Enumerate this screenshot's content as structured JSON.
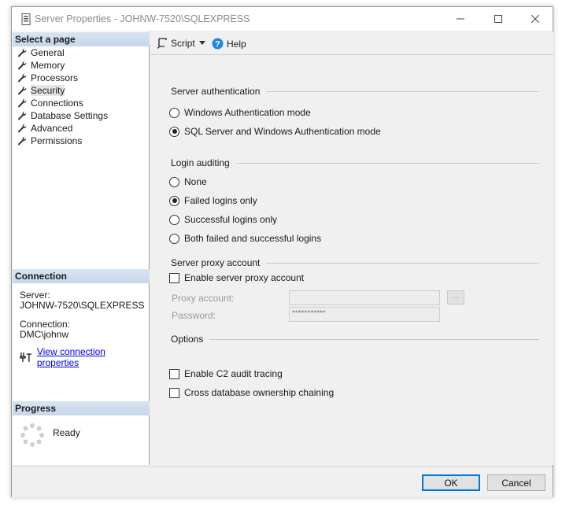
{
  "window": {
    "title": "Server Properties - JOHNW-7520\\SQLEXPRESS"
  },
  "left_pane": {
    "select_page_header": "Select a page",
    "pages": [
      {
        "label": "General",
        "selected": false
      },
      {
        "label": "Memory",
        "selected": false
      },
      {
        "label": "Processors",
        "selected": false
      },
      {
        "label": "Security",
        "selected": true
      },
      {
        "label": "Connections",
        "selected": false
      },
      {
        "label": "Database Settings",
        "selected": false
      },
      {
        "label": "Advanced",
        "selected": false
      },
      {
        "label": "Permissions",
        "selected": false
      }
    ],
    "connection_header": "Connection",
    "server_label": "Server:",
    "server_value": "JOHNW-7520\\SQLEXPRESS",
    "connection_label": "Connection:",
    "connection_value": "DMC\\johnw",
    "view_connection_link": "View connection properties",
    "progress_header": "Progress",
    "progress_status": "Ready"
  },
  "toolbar": {
    "script_label": "Script",
    "help_label": "Help"
  },
  "security": {
    "server_auth_title": "Server authentication",
    "server_auth_options": [
      {
        "label": "Windows Authentication mode",
        "checked": false
      },
      {
        "label": "SQL Server and Windows Authentication mode",
        "checked": true
      }
    ],
    "login_auditing_title": "Login auditing",
    "login_auditing_options": [
      {
        "label": "None",
        "checked": false
      },
      {
        "label": "Failed logins only",
        "checked": true
      },
      {
        "label": "Successful logins only",
        "checked": false
      },
      {
        "label": "Both failed and successful logins",
        "checked": false
      }
    ],
    "proxy_title": "Server proxy account",
    "enable_proxy_label": "Enable server proxy account",
    "enable_proxy_checked": false,
    "proxy_account_label": "Proxy account:",
    "proxy_account_value": "",
    "browse_label": "...",
    "password_label": "Password:",
    "password_value": "***********",
    "options_title": "Options",
    "c2_audit_label": "Enable C2 audit tracing",
    "c2_audit_checked": false,
    "cross_db_label": "Cross database ownership chaining",
    "cross_db_checked": false
  },
  "footer": {
    "ok_label": "OK",
    "cancel_label": "Cancel"
  },
  "colors": {
    "section_header_bg": "#c6d7ea",
    "link": "#0000ee",
    "help_icon": "#1e88e5",
    "ok_border": "#0078d7"
  }
}
